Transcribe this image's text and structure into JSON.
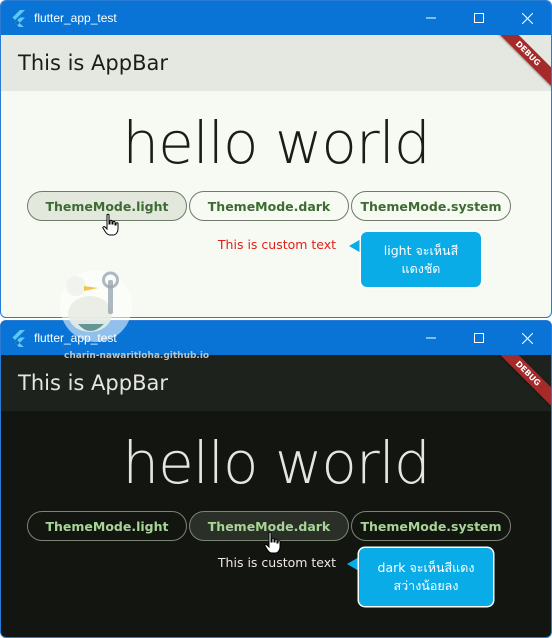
{
  "windows": [
    {
      "title": "flutter_app_test",
      "appbar_title": "This is AppBar",
      "debug_label": "DEBUG",
      "headline": "hello world",
      "buttons": [
        "ThemeMode.light",
        "ThemeMode.dark",
        "ThemeMode.system"
      ],
      "custom_text": "This is custom text",
      "callout": "light จะเห็นสีแดงชัด",
      "hovered_button": "ThemeMode.light"
    },
    {
      "title": "flutter_app_test",
      "appbar_title": "This is AppBar",
      "debug_label": "DEBUG",
      "headline": "hello world",
      "buttons": [
        "ThemeMode.light",
        "ThemeMode.dark",
        "ThemeMode.system"
      ],
      "custom_text": "This is custom text",
      "callout": "dark จะเห็นสีแดงสว่างน้อยลง",
      "hovered_button": "ThemeMode.dark"
    }
  ],
  "watermark": {
    "text": "charin-nawaritloha.github.io"
  },
  "colors": {
    "titlebar": "#0a74d6",
    "debug_ribbon": "#a52a2a",
    "callout": "#0aace8",
    "light_custom_text": "#e0201a",
    "dark_custom_text": "#f0e8e4",
    "light_button_text": "#3e6b33",
    "dark_button_text": "#a8d597"
  },
  "icons": [
    "flutter-logo-icon",
    "minimize-icon",
    "maximize-icon",
    "close-icon",
    "hand-pointer-icon",
    "duck-wrench-watermark"
  ]
}
